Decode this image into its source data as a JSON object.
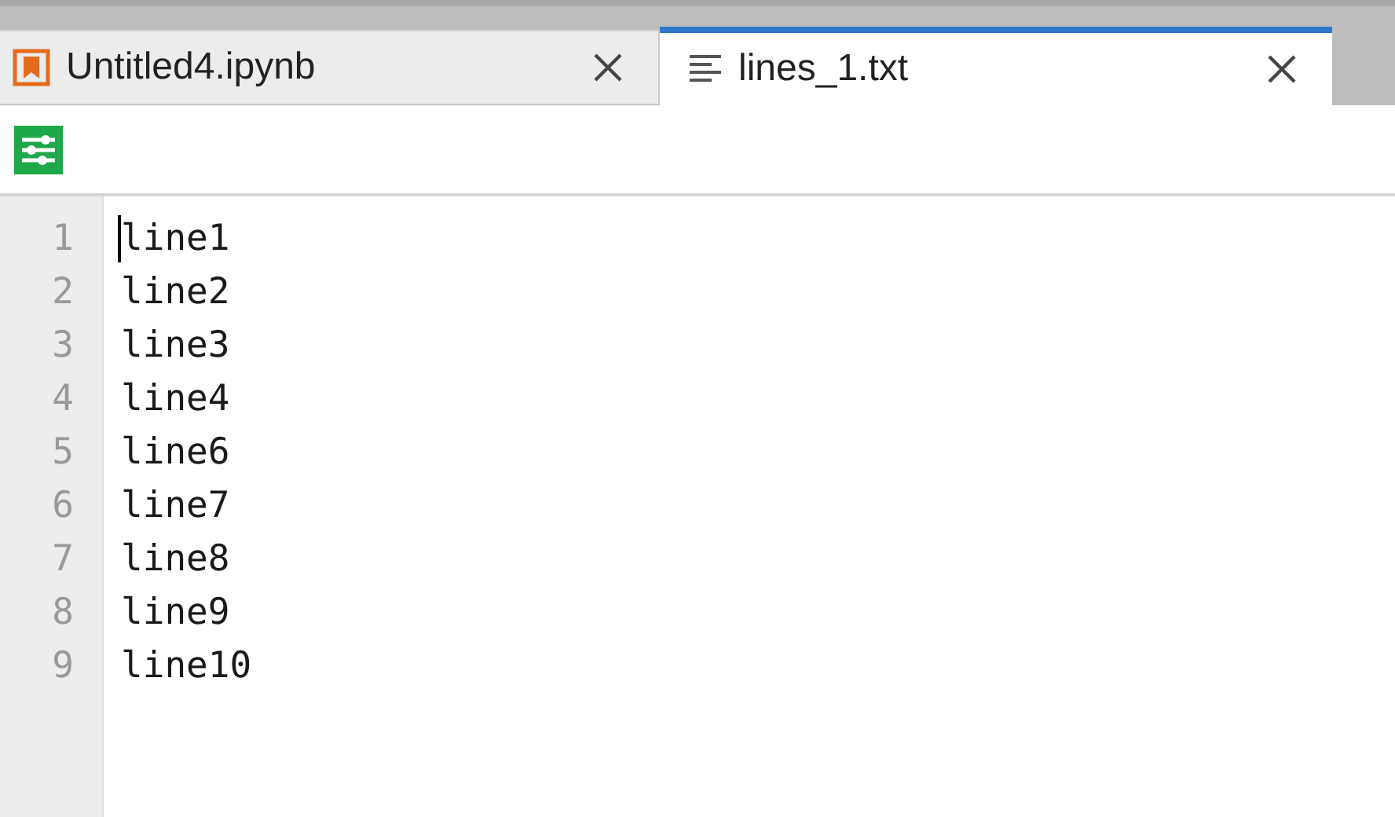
{
  "tabs": [
    {
      "kind": "notebook",
      "label": "Untitled4.ipynb",
      "selected": false
    },
    {
      "kind": "text",
      "label": "lines_1.txt",
      "selected": true
    }
  ],
  "editor": {
    "lines": [
      {
        "number": "1",
        "text": "line1",
        "cursor": true
      },
      {
        "number": "2",
        "text": "line2",
        "cursor": false
      },
      {
        "number": "3",
        "text": "line3",
        "cursor": false
      },
      {
        "number": "4",
        "text": "line4",
        "cursor": false
      },
      {
        "number": "5",
        "text": "line6",
        "cursor": false
      },
      {
        "number": "6",
        "text": "line7",
        "cursor": false
      },
      {
        "number": "7",
        "text": "line8",
        "cursor": false
      },
      {
        "number": "8",
        "text": "line9",
        "cursor": false
      },
      {
        "number": "9",
        "text": "line10",
        "cursor": false
      }
    ]
  }
}
